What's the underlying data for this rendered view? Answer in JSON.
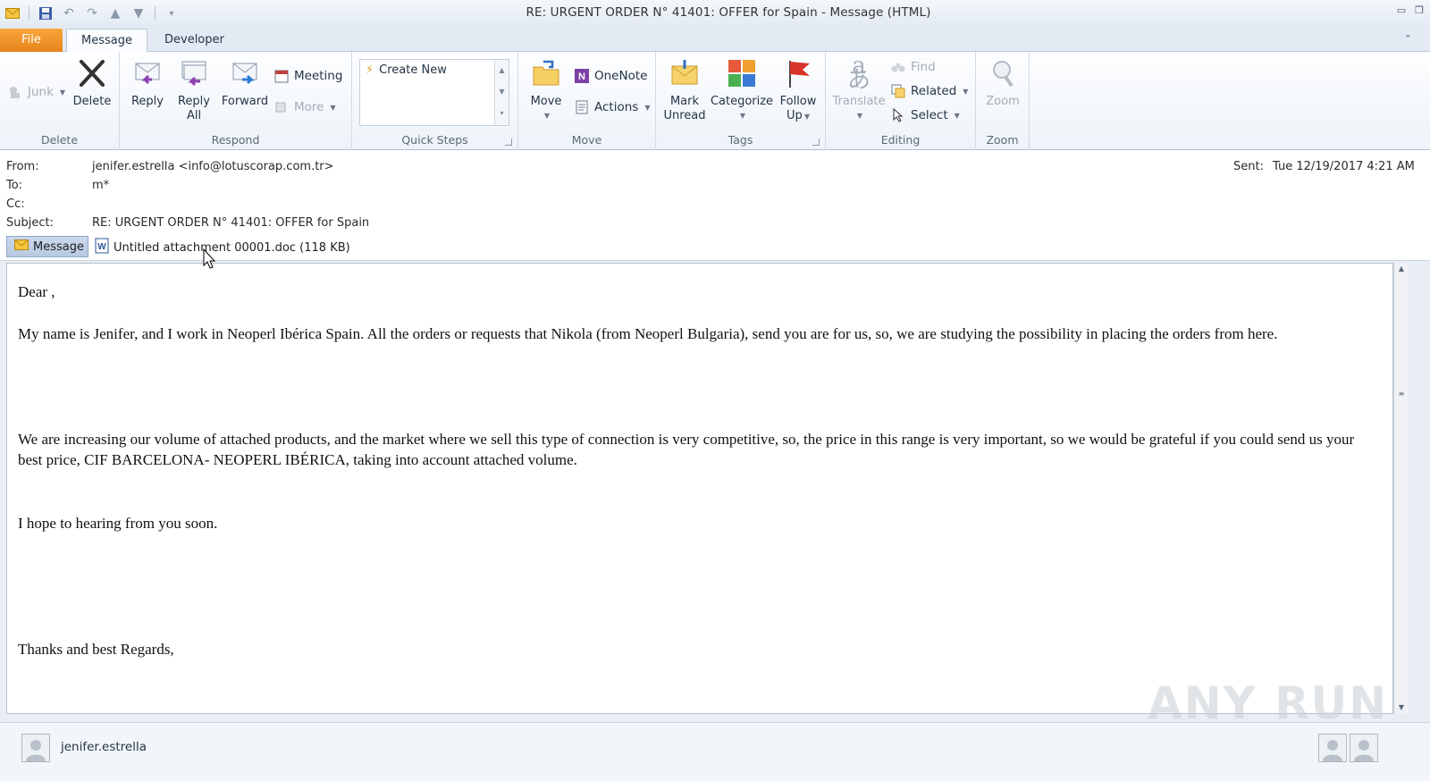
{
  "window": {
    "title": "RE: URGENT ORDER N° 41401: OFFER for  Spain  -  Message (HTML)"
  },
  "tabs": [
    {
      "label": "File"
    },
    {
      "label": "Message"
    },
    {
      "label": "Developer"
    }
  ],
  "ribbon": {
    "delete_group": {
      "label": "Delete",
      "junk": "Junk",
      "delete": "Delete"
    },
    "respond_group": {
      "label": "Respond",
      "reply": "Reply",
      "reply_all_1": "Reply",
      "reply_all_2": "All",
      "forward": "Forward",
      "meeting": "Meeting",
      "more": "More"
    },
    "quick_steps": {
      "label": "Quick Steps",
      "create_new": "Create New"
    },
    "move_group": {
      "label": "Move",
      "move": "Move",
      "onenote": "OneNote",
      "actions": "Actions"
    },
    "tags_group": {
      "label": "Tags",
      "mark_unread_1": "Mark",
      "mark_unread_2": "Unread",
      "categorize": "Categorize",
      "follow_up_1": "Follow",
      "follow_up_2": "Up"
    },
    "editing_group": {
      "label": "Editing",
      "translate": "Translate",
      "find": "Find",
      "related": "Related",
      "select": "Select"
    },
    "zoom_group": {
      "label": "Zoom",
      "zoom": "Zoom"
    }
  },
  "header": {
    "from_label": "From:",
    "from_value": "jenifer.estrella <info@lotuscorap.com.tr>",
    "to_label": "To:",
    "to_value": "m*",
    "cc_label": "Cc:",
    "cc_value": "",
    "subject_label": "Subject:",
    "subject_value": "RE: URGENT ORDER N° 41401: OFFER for  Spain",
    "sent_label": "Sent:",
    "sent_value": "Tue 12/19/2017 4:21 AM"
  },
  "attachments": {
    "message_label": "Message",
    "file": "Untitled attachment 00001.doc (118 KB)"
  },
  "body": {
    "greeting": "Dear ,",
    "para1": "My name is Jenifer, and I work in Neoperl Ibérica Spain. All the orders or requests that Nikola (from Neoperl Bulgaria),  send you are for us, so, we are studying the possibility in placing the orders from here.",
    "para2": "We are increasing our volume of attached products, and the market where we sell this type of connection is very competitive, so, the price in this range is very important, so we would be grateful if you could send us your best price, CIF BARCELONA- NEOPERL IBÉRICA, taking into account attached volume.",
    "para3": "I hope to hearing from you soon.",
    "closing": "Thanks and best Regards,"
  },
  "people_pane": {
    "name": "jenifer.estrella"
  },
  "watermark": "ANY RUN",
  "colors": {
    "file_tab": "#e8821c",
    "ribbon_bg": "#eef3f9",
    "accent": "#2b579a"
  }
}
